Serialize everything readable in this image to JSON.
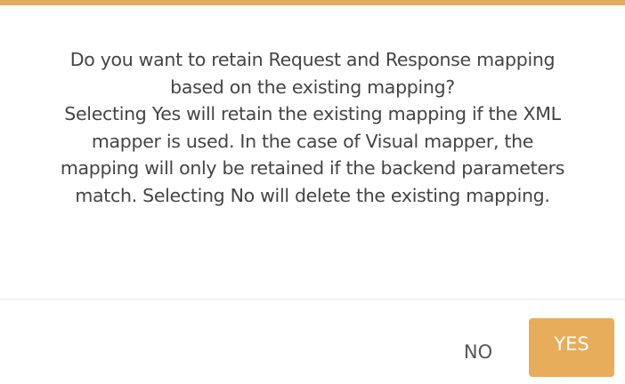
{
  "dialog": {
    "accent_color": "#e1ad63",
    "message_lines": [
      "Do you want to retain Request and Response mapping",
      "based on the existing mapping?",
      "Selecting Yes will retain the existing mapping if the XML",
      "mapper is used. In the case of Visual mapper, the",
      "mapping will only be retained if the backend parameters",
      "match. Selecting No will delete the existing mapping."
    ],
    "no_label": "NO",
    "yes_label": "YES"
  }
}
